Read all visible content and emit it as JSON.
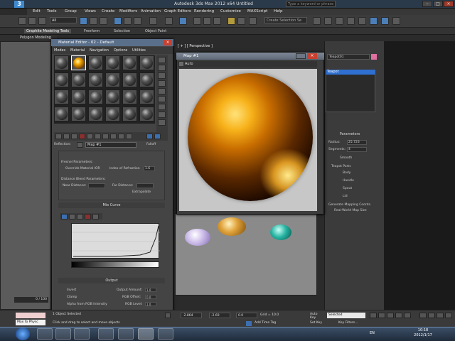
{
  "window": {
    "title": "Autodesk 3ds Max 2012 x64      Untitled",
    "search_placeholder": "Type a keyword or phrase"
  },
  "menu": [
    "Edit",
    "Tools",
    "Group",
    "Views",
    "Create",
    "Modifiers",
    "Animation",
    "Graph Editors",
    "Rendering",
    "Customize",
    "MAXScript",
    "Help"
  ],
  "toolbar": {
    "selection_filter": "All",
    "named_selection": "Create Selection Se"
  },
  "ribbon": {
    "tabs": [
      "Graphite Modeling Tools",
      "Freeform",
      "Selection",
      "Object Paint"
    ],
    "sub_label": "Polygon Modeling"
  },
  "material_editor": {
    "title": "Material Editor - 02 - Default",
    "menu": [
      "Modes",
      "Material",
      "Navigation",
      "Options",
      "Utilities"
    ],
    "reflection_label": "Reflection:",
    "map_name": "Map #1",
    "map_type": "Falloff",
    "fresnel_params_label": "Fresnel Parameters:",
    "override_label": "Override Material IOR",
    "ior_label": "Index of Refraction",
    "ior_value": "1.6",
    "distance_blend_label": "Distance Blend Parameters:",
    "near_distance_label": "Near Distance:",
    "far_distance_label": "Far Distance:",
    "extrapolate_label": "Extrapolate",
    "mix_curve_label": "Mix Curve",
    "output_label": "Output",
    "invert_label": "Invert",
    "clamp_label": "Clamp",
    "alpha_label": "Alpha from RGB Intensity",
    "output_amount_label": "Output Amount:",
    "output_amount": "1.0",
    "rgb_offset_label": "RGB Offset:",
    "rgb_offset": "0.0",
    "rgb_level_label": "RGB Level:",
    "rgb_level": "1.0"
  },
  "map_window": {
    "title": "Map #1",
    "toolbar_label": "Auto"
  },
  "viewport": {
    "label": "[ + ] [ Perspective ]",
    "left_frame": "0 / 100"
  },
  "command_panel": {
    "object_name": "Teapot01",
    "list_selected": "Teapot",
    "params_title": "Parameters",
    "radius_label": "Radius:",
    "radius_value": "25.723",
    "segments_label": "Segments:",
    "segments_value": "4",
    "smooth_label": "Smooth",
    "teapot_parts_label": "Teapot Parts",
    "parts": [
      "Body",
      "Handle",
      "Spout",
      "Lid"
    ],
    "mapping_label": "Generate Mapping Coords.",
    "real_world_label": "Real-World Map Size"
  },
  "statusbar": {
    "line1": "1 Object Selected",
    "line2": "Click and drag to select and move objects",
    "maxscript_hint": "Max to Physc",
    "x_value": "-2.864",
    "y_value": "-2.69",
    "z_value": "0.0",
    "grid_label": "Grid = 10.0",
    "add_time_tag": "Add Time Tag",
    "auto_key": "Auto Key",
    "set_key": "Set Key",
    "selected_option": "Selected",
    "key_filters": "Key Filters..."
  },
  "taskbar": {
    "lang": "EN",
    "time": "10:18",
    "date": "2012/1/17"
  },
  "colors": {
    "titlebar": "#2a3a4a",
    "selection_blue": "#2e6fcf",
    "close_red": "#c84030",
    "sphere_gold": "#f7b21a"
  }
}
